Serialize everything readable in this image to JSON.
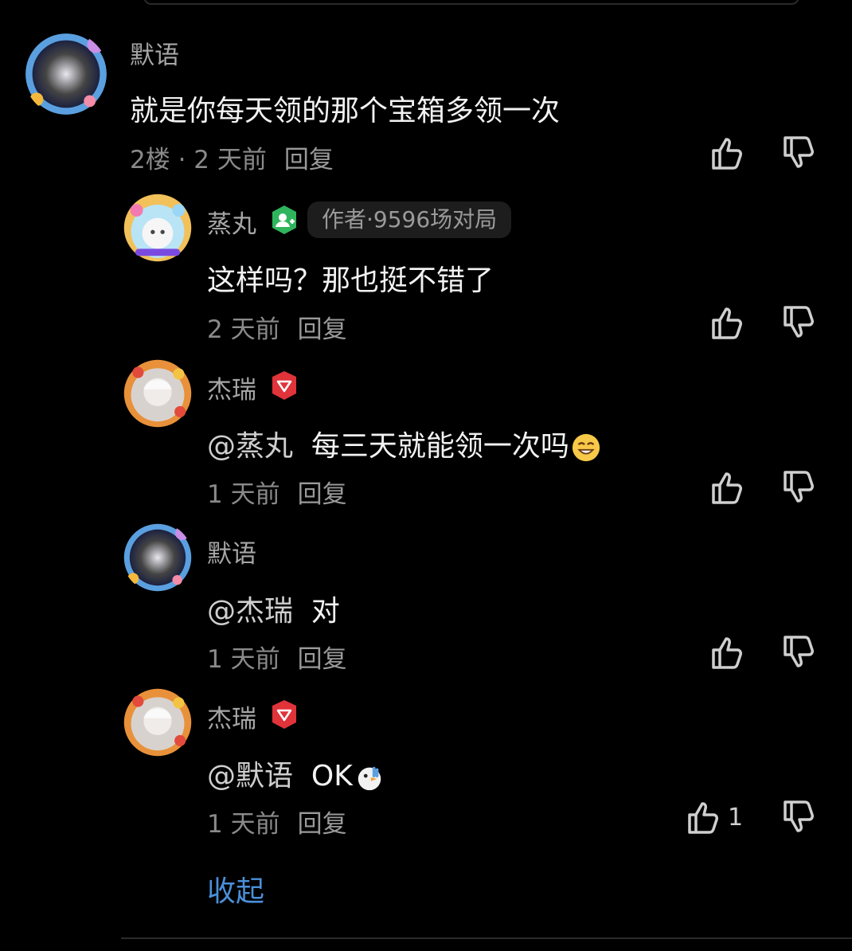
{
  "comments": [
    {
      "author": "默语",
      "text": "就是你每天领的那个宝箱多领一次",
      "floor": "2楼 · 2 天前",
      "reply": "回复"
    },
    {
      "author": "蒸丸",
      "author_badge": "作者·9596场对局",
      "text": "这样吗？那也挺不错了",
      "time": "2 天前",
      "reply": "回复"
    },
    {
      "author": "杰瑞",
      "mention": "@蒸丸",
      "text": "每三天就能领一次吗",
      "time": "1 天前",
      "reply": "回复"
    },
    {
      "author": "默语",
      "mention": "@杰瑞",
      "text": "对",
      "time": "1 天前",
      "reply": "回复"
    },
    {
      "author": "杰瑞",
      "mention": "@默语",
      "text": "OK",
      "time": "1 天前",
      "reply": "回复",
      "like_count": "1"
    }
  ],
  "collapse_label": "收起",
  "icons": {
    "like": "thumbs-up-icon",
    "dislike": "thumbs-down-icon",
    "author_badge": "green-user-badge-icon",
    "level_badge": "red-shield-icon",
    "emoji_smile": "grinning-face-emoji",
    "emoji_bird": "bird-thumbs-emoji"
  },
  "colors": {
    "background": "#000000",
    "link": "#4a90d9",
    "name": "#a6a6a6",
    "badge_green": "#2fb55d",
    "badge_red": "#e0333a"
  }
}
